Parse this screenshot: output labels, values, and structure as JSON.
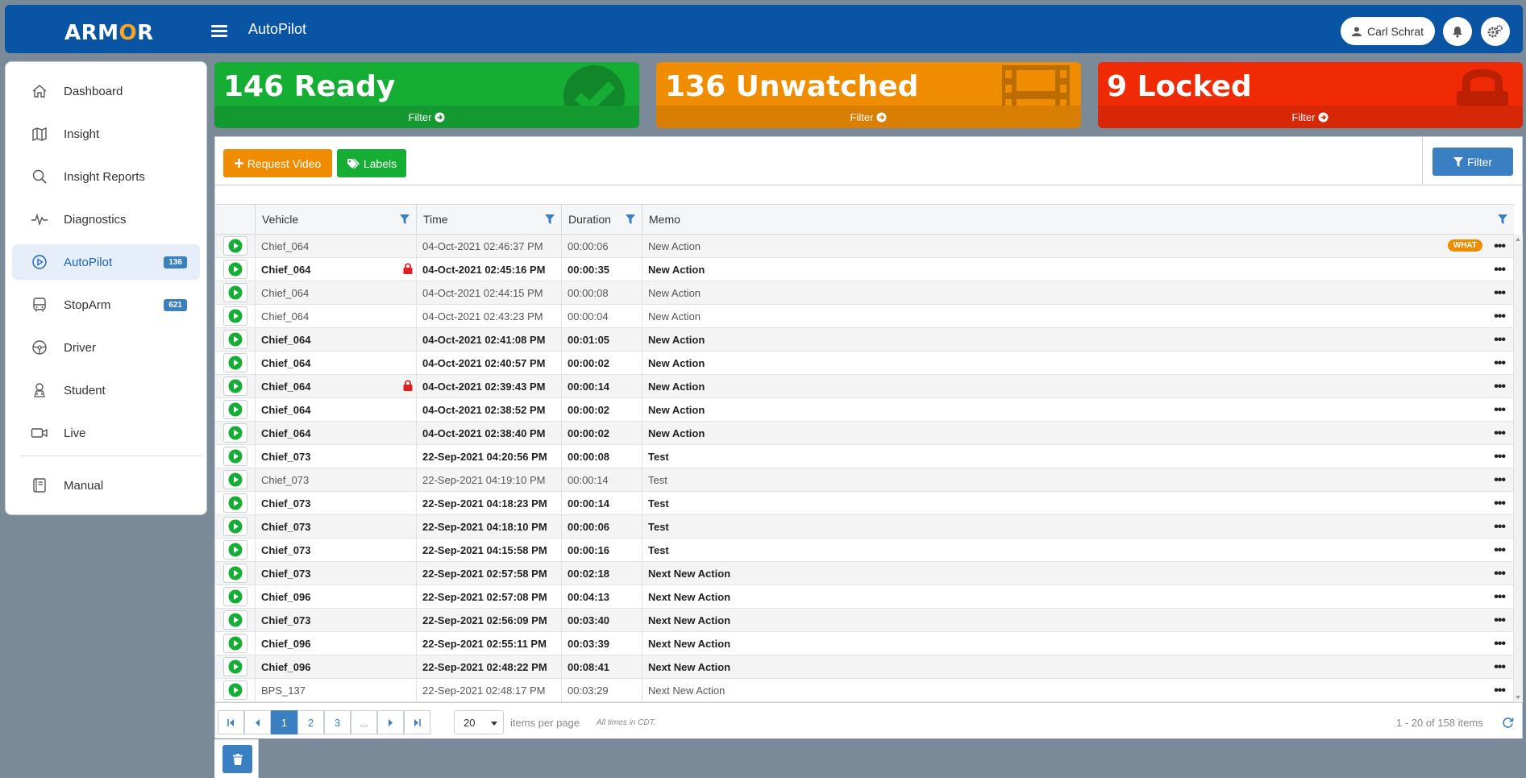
{
  "header": {
    "logo": "ARMOR",
    "logo_parts": [
      "ARM",
      "O",
      "R"
    ],
    "title": "AutoPilot",
    "user_name": "Carl Schrat"
  },
  "sidebar": {
    "items": [
      {
        "label": "Dashboard",
        "icon": "home-icon"
      },
      {
        "label": "Insight",
        "icon": "map-icon"
      },
      {
        "label": "Insight Reports",
        "icon": "search-icon"
      },
      {
        "label": "Diagnostics",
        "icon": "pulse-icon"
      },
      {
        "label": "AutoPilot",
        "icon": "play-circle-icon",
        "badge": "136",
        "active": true
      },
      {
        "label": "StopArm",
        "icon": "bus-icon",
        "badge": "621"
      },
      {
        "label": "Driver",
        "icon": "steering-wheel-icon"
      },
      {
        "label": "Student",
        "icon": "student-icon"
      },
      {
        "label": "Live",
        "icon": "video-camera-icon"
      },
      {
        "label": "Manual",
        "icon": "book-icon"
      }
    ]
  },
  "cards": {
    "ready": {
      "text": "146 Ready",
      "filter": "Filter"
    },
    "unwatched": {
      "text": "136 Unwatched",
      "filter": "Filter"
    },
    "locked": {
      "text": "9 Locked",
      "filter": "Filter"
    }
  },
  "toolbar": {
    "request_video": "Request Video",
    "labels": "Labels",
    "filter": "Filter"
  },
  "grid": {
    "columns": [
      "Vehicle",
      "Time",
      "Duration",
      "Memo"
    ],
    "rows": [
      {
        "vehicle": "Chief_064",
        "time": "04-Oct-2021 02:46:37 PM",
        "duration": "00:00:06",
        "memo": "New Action",
        "unread": false,
        "locked": false,
        "tag": "WHAT"
      },
      {
        "vehicle": "Chief_064",
        "time": "04-Oct-2021 02:45:16 PM",
        "duration": "00:00:35",
        "memo": "New Action",
        "unread": true,
        "locked": true
      },
      {
        "vehicle": "Chief_064",
        "time": "04-Oct-2021 02:44:15 PM",
        "duration": "00:00:08",
        "memo": "New Action",
        "unread": false,
        "locked": false
      },
      {
        "vehicle": "Chief_064",
        "time": "04-Oct-2021 02:43:23 PM",
        "duration": "00:00:04",
        "memo": "New Action",
        "unread": false,
        "locked": false
      },
      {
        "vehicle": "Chief_064",
        "time": "04-Oct-2021 02:41:08 PM",
        "duration": "00:01:05",
        "memo": "New Action",
        "unread": true,
        "locked": false
      },
      {
        "vehicle": "Chief_064",
        "time": "04-Oct-2021 02:40:57 PM",
        "duration": "00:00:02",
        "memo": "New Action",
        "unread": true,
        "locked": false
      },
      {
        "vehicle": "Chief_064",
        "time": "04-Oct-2021 02:39:43 PM",
        "duration": "00:00:14",
        "memo": "New Action",
        "unread": true,
        "locked": true
      },
      {
        "vehicle": "Chief_064",
        "time": "04-Oct-2021 02:38:52 PM",
        "duration": "00:00:02",
        "memo": "New Action",
        "unread": true,
        "locked": false
      },
      {
        "vehicle": "Chief_064",
        "time": "04-Oct-2021 02:38:40 PM",
        "duration": "00:00:02",
        "memo": "New Action",
        "unread": true,
        "locked": false
      },
      {
        "vehicle": "Chief_073",
        "time": "22-Sep-2021 04:20:56 PM",
        "duration": "00:00:08",
        "memo": "Test",
        "unread": true,
        "locked": false
      },
      {
        "vehicle": "Chief_073",
        "time": "22-Sep-2021 04:19:10 PM",
        "duration": "00:00:14",
        "memo": "Test",
        "unread": false,
        "locked": false
      },
      {
        "vehicle": "Chief_073",
        "time": "22-Sep-2021 04:18:23 PM",
        "duration": "00:00:14",
        "memo": "Test",
        "unread": true,
        "locked": false
      },
      {
        "vehicle": "Chief_073",
        "time": "22-Sep-2021 04:18:10 PM",
        "duration": "00:00:06",
        "memo": "Test",
        "unread": true,
        "locked": false
      },
      {
        "vehicle": "Chief_073",
        "time": "22-Sep-2021 04:15:58 PM",
        "duration": "00:00:16",
        "memo": "Test",
        "unread": true,
        "locked": false
      },
      {
        "vehicle": "Chief_073",
        "time": "22-Sep-2021 02:57:58 PM",
        "duration": "00:02:18",
        "memo": "Next New Action",
        "unread": true,
        "locked": false
      },
      {
        "vehicle": "Chief_096",
        "time": "22-Sep-2021 02:57:08 PM",
        "duration": "00:04:13",
        "memo": "Next New Action",
        "unread": true,
        "locked": false
      },
      {
        "vehicle": "Chief_073",
        "time": "22-Sep-2021 02:56:09 PM",
        "duration": "00:03:40",
        "memo": "Next New Action",
        "unread": true,
        "locked": false
      },
      {
        "vehicle": "Chief_096",
        "time": "22-Sep-2021 02:55:11 PM",
        "duration": "00:03:39",
        "memo": "Next New Action",
        "unread": true,
        "locked": false
      },
      {
        "vehicle": "Chief_096",
        "time": "22-Sep-2021 02:48:22 PM",
        "duration": "00:08:41",
        "memo": "Next New Action",
        "unread": true,
        "locked": false
      },
      {
        "vehicle": "BPS_137",
        "time": "22-Sep-2021 02:48:17 PM",
        "duration": "00:03:29",
        "memo": "Next New Action",
        "unread": false,
        "locked": false
      }
    ]
  },
  "pager": {
    "pages": [
      "1",
      "2",
      "3",
      "..."
    ],
    "current": "1",
    "per_page": "20",
    "per_page_label": "items per page",
    "timezone_note": "All times in CDT.",
    "summary": "1 - 20 of 158 items"
  },
  "colors": {
    "brand": "#0a55a3",
    "ready": "#16ad35",
    "unwatched": "#f08c00",
    "locked": "#f02a05",
    "accent": "#3a7fc1"
  }
}
